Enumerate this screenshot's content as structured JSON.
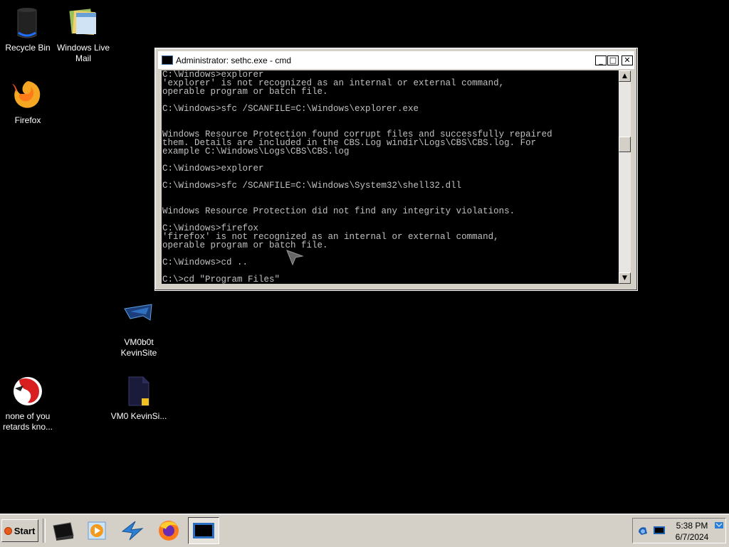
{
  "desktop": {
    "icons": [
      {
        "label": "Recycle Bin"
      },
      {
        "label": "Windows Live Mail"
      },
      {
        "label": "Firefox"
      },
      {
        "label": "VM0b0t KevinSite"
      },
      {
        "label": "none of you retards kno..."
      },
      {
        "label": "VM0 KevinSi..."
      }
    ]
  },
  "window": {
    "title": "Administrator: sethc.exe - cmd",
    "buttons": {
      "minimize": "_",
      "maximize": "□",
      "close": "✕"
    },
    "console_lines": "C:\\Windows>explorer\n'explorer' is not recognized as an internal or external command,\noperable program or batch file.\n\nC:\\Windows>sfc /SCANFILE=C:\\Windows\\explorer.exe\n\n\nWindows Resource Protection found corrupt files and successfully repaired\nthem. Details are included in the CBS.Log windir\\Logs\\CBS\\CBS.log. For\nexample C:\\Windows\\Logs\\CBS\\CBS.log\n\nC:\\Windows>explorer\n\nC:\\Windows>sfc /SCANFILE=C:\\Windows\\System32\\shell32.dll\n\n\nWindows Resource Protection did not find any integrity violations.\n\nC:\\Windows>firefox\n'firefox' is not recognized as an internal or external command,\noperable program or batch file.\n\nC:\\Windows>cd ..\n\nC:\\>cd \"Program Files\"",
    "scroll_up": "▲",
    "scroll_down": "▼"
  },
  "taskbar": {
    "start_label": "Start",
    "apps": [
      {
        "icon": "console-app-icon"
      },
      {
        "icon": "media-player-icon"
      },
      {
        "icon": "mail-app-icon"
      },
      {
        "icon": "firefox-icon"
      },
      {
        "icon": "cmd-window-icon",
        "active": true
      }
    ],
    "clock": {
      "time": "5:38 PM",
      "date": "6/7/2024"
    }
  },
  "colors": {
    "desktop_bg": "#000000",
    "console_bg": "#000000",
    "console_text": "#c0c0c0",
    "chrome": "#d4d0c8"
  }
}
